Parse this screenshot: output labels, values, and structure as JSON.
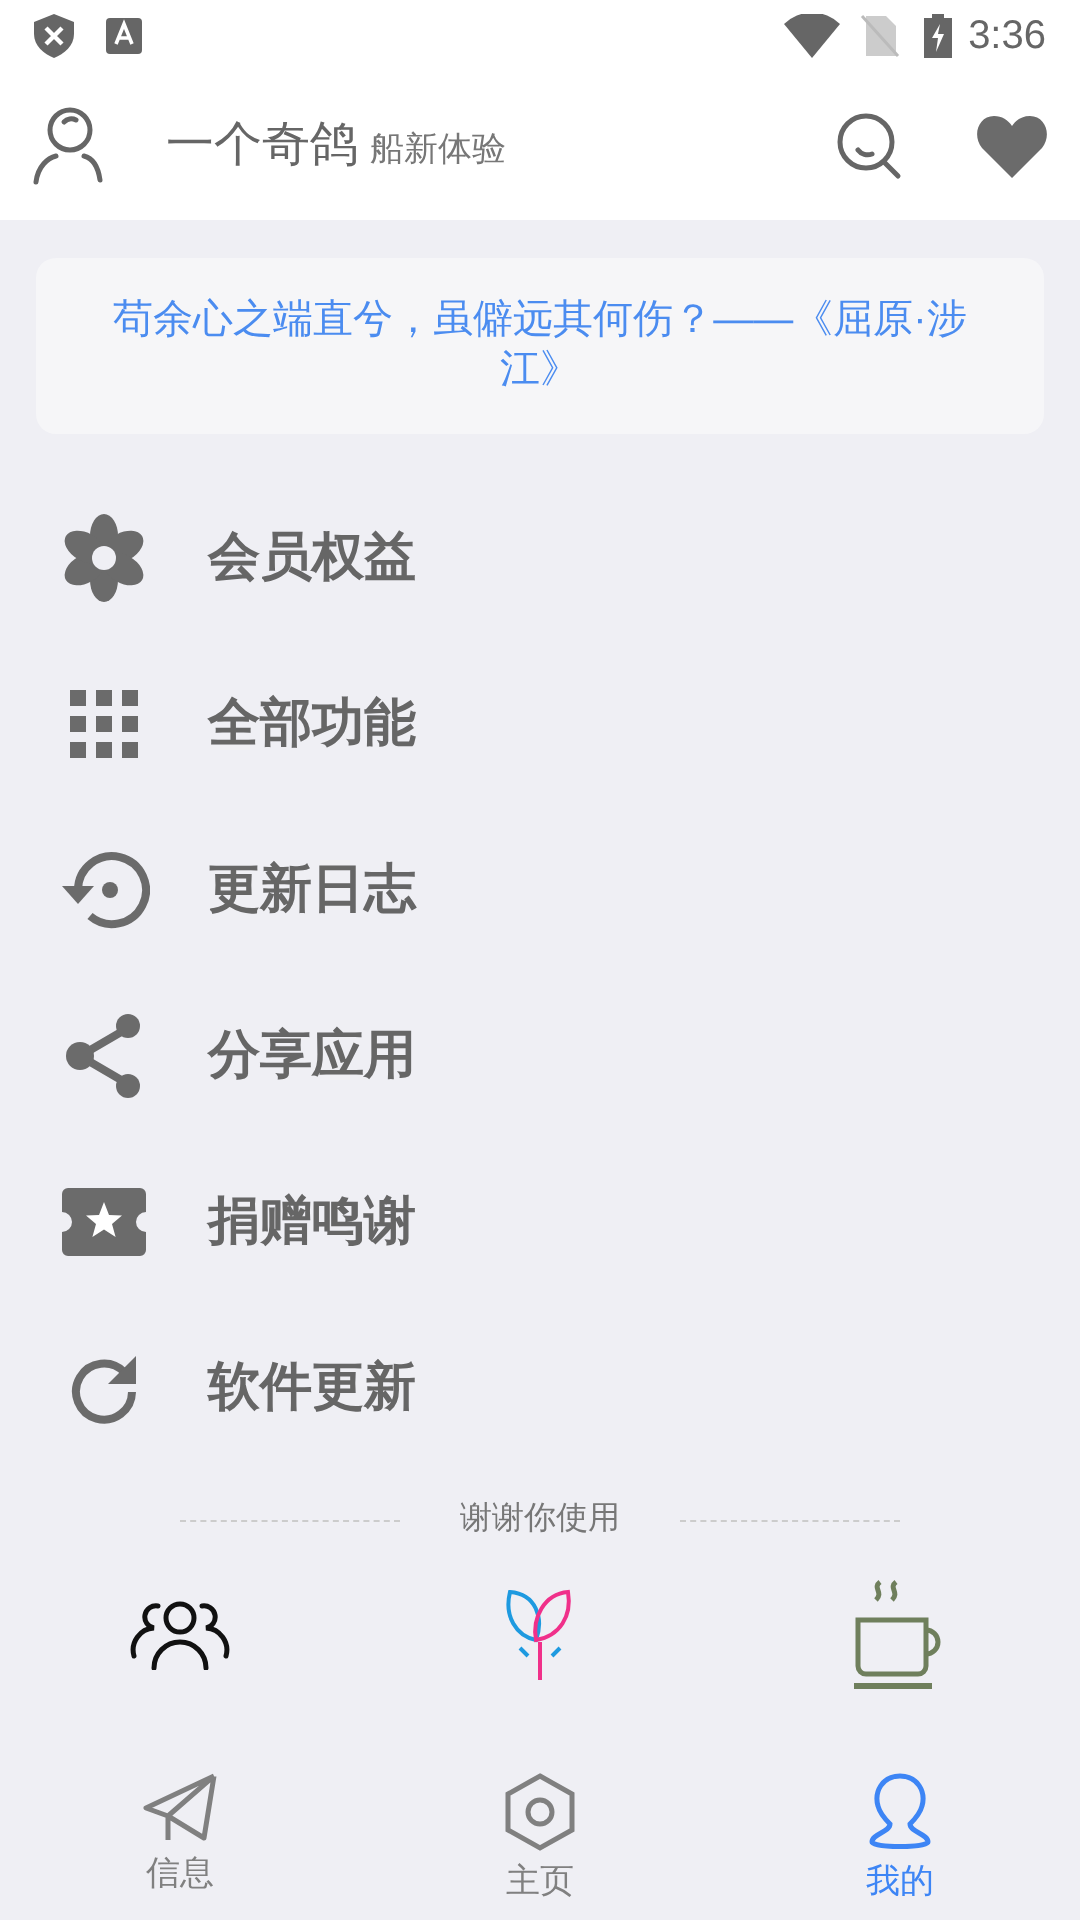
{
  "status_bar": {
    "time": "3:36"
  },
  "header": {
    "title": "一个奇鸽",
    "subtitle": "船新体验"
  },
  "quote": "苟余心之端直兮，虽僻远其何伤？——《屈原·涉江》",
  "menu": [
    {
      "label": "会员权益",
      "kind": "flower"
    },
    {
      "label": "全部功能",
      "kind": "grid"
    },
    {
      "label": "更新日志",
      "kind": "history"
    },
    {
      "label": "分享应用",
      "kind": "share"
    },
    {
      "label": "捐赠鸣谢",
      "kind": "ticket"
    },
    {
      "label": "软件更新",
      "kind": "refresh"
    }
  ],
  "footer_note": "谢谢你使用",
  "shortcuts": [
    {
      "kind": "people"
    },
    {
      "kind": "sprout"
    },
    {
      "kind": "cup"
    }
  ],
  "bottom_nav": [
    {
      "label": "信息",
      "kind": "send",
      "selected": false
    },
    {
      "label": "主页",
      "kind": "hexagon",
      "selected": false
    },
    {
      "label": "我的",
      "kind": "person",
      "selected": true
    }
  ]
}
